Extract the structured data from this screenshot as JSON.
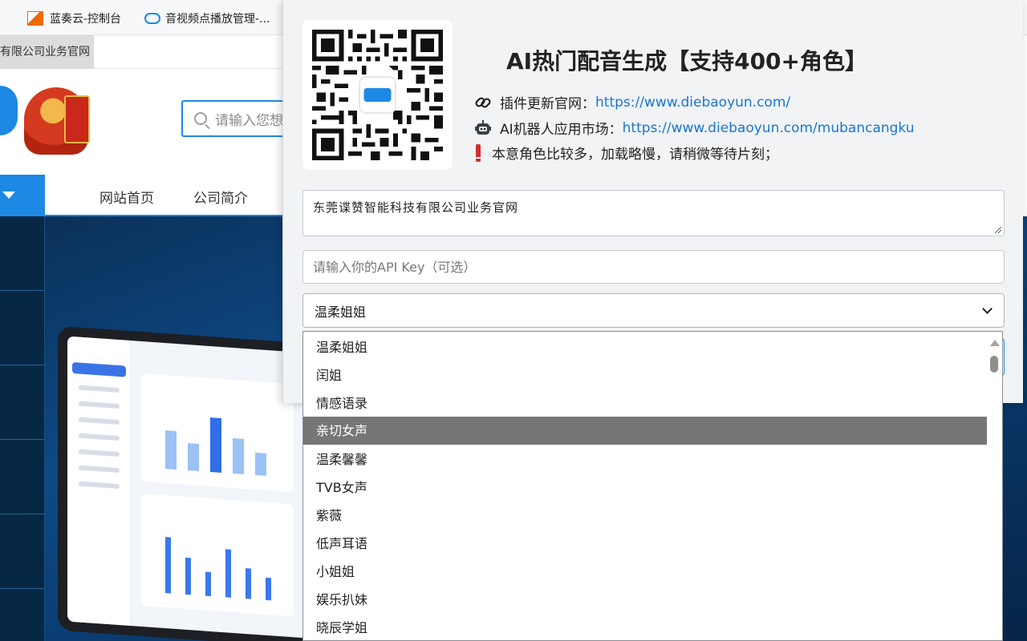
{
  "bookmarks": [
    {
      "label": "蓝奏云-控制台",
      "icon": "lanzou-icon"
    },
    {
      "label": "音视频点播放管理-...",
      "icon": "cloud-icon"
    }
  ],
  "site": {
    "tab_crumb": "有限公司业务官网",
    "search_placeholder": "请输入您想",
    "nav_home": "网站首页",
    "nav_about": "公司简介"
  },
  "popup": {
    "title": "AI热门配音生成【支持400+角色】",
    "plugin_label": "插件更新官网：",
    "plugin_url": "https://www.diebaoyun.com/",
    "market_label": "AI机器人应用市场：",
    "market_url": "https://www.diebaoyun.com/mubancangku",
    "note": "本意角色比较多，加载略慢，请稍微等待片刻；",
    "text_value": "东莞谍赞智能科技有限公司业务官网",
    "api_placeholder": "请输入你的API Key（可选）",
    "selected_voice": "温柔姐姐",
    "colors": {
      "link": "#1976d2",
      "warning": "#d32f2f",
      "highlight": "#767676"
    }
  },
  "dropdown": {
    "options": [
      "温柔姐姐",
      "闰姐",
      "情感语录",
      "亲切女声",
      "温柔馨馨",
      "TVB女声",
      "紫薇",
      "低声耳语",
      "小姐姐",
      "娱乐扒妹",
      "晓辰学姐"
    ],
    "highlighted": "亲切女声"
  }
}
